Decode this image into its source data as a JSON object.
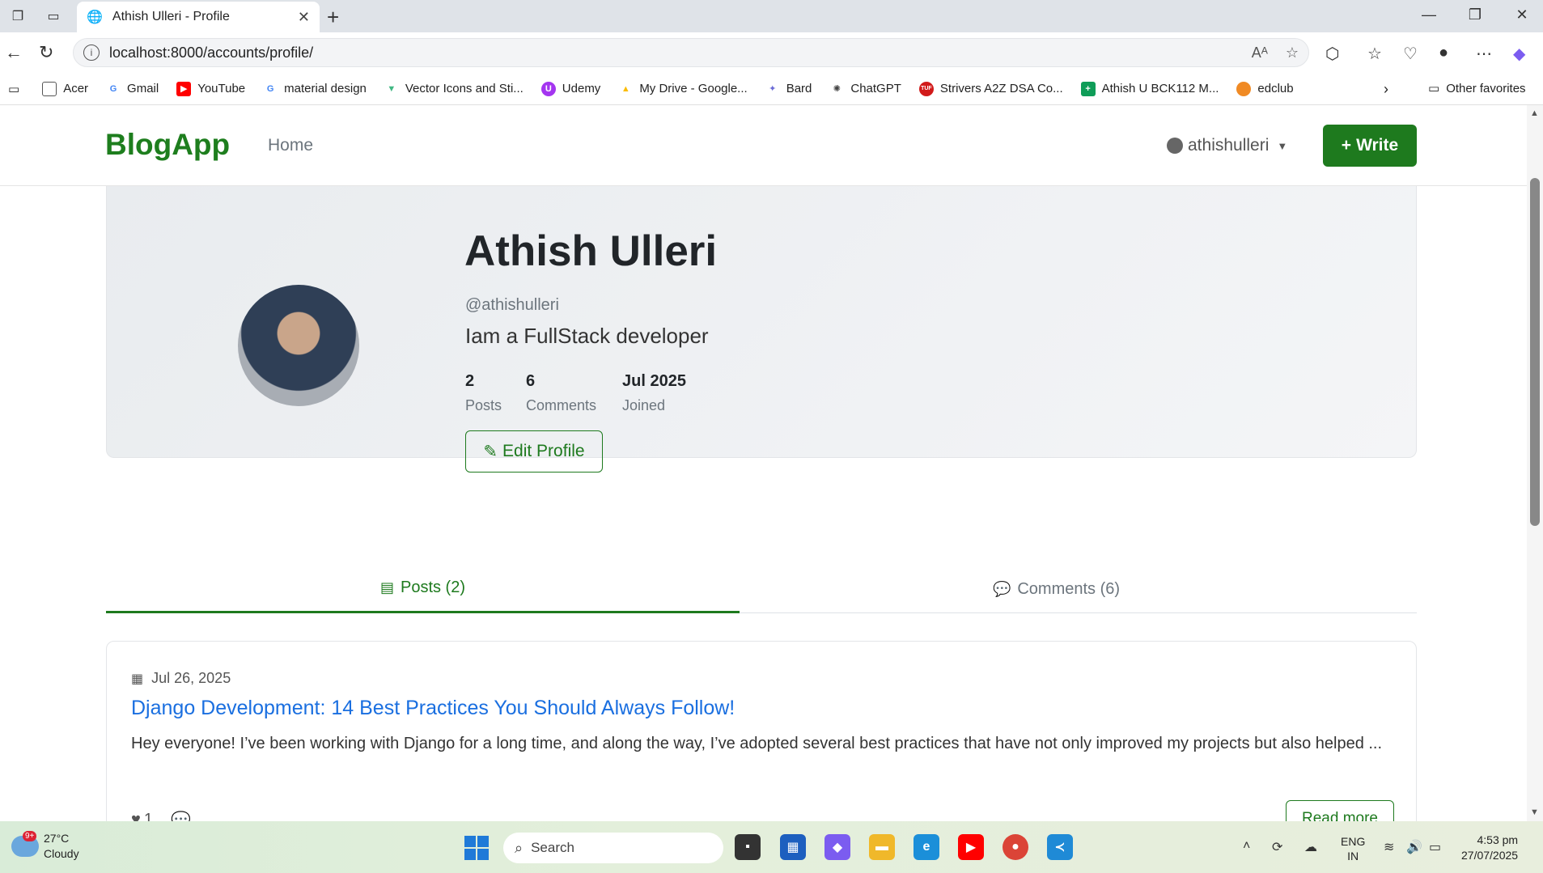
{
  "browser": {
    "tab_title": "Athish Ulleri - Profile",
    "url": "localhost:8000/accounts/profile/",
    "bookmarks": [
      {
        "label": "Acer",
        "icon": "folder-icon",
        "color": "#555555"
      },
      {
        "label": "Gmail",
        "icon": "google-icon",
        "color": "#4285f4"
      },
      {
        "label": "YouTube",
        "icon": "youtube-icon",
        "color": "#ff0000"
      },
      {
        "label": "material design",
        "icon": "google-icon",
        "color": "#4285f4"
      },
      {
        "label": "Vector Icons and Sti...",
        "icon": "vector-icon",
        "color": "#41b883"
      },
      {
        "label": "Udemy",
        "icon": "udemy-icon",
        "color": "#a435f0"
      },
      {
        "label": "My Drive - Google...",
        "icon": "drive-icon",
        "color": "#fbbc04"
      },
      {
        "label": "Bard",
        "icon": "sparkle-icon",
        "color": "#6b6bd6"
      },
      {
        "label": "ChatGPT",
        "icon": "chatgpt-icon",
        "color": "#444444"
      },
      {
        "label": "Strivers A2Z DSA Co...",
        "icon": "tuf-icon",
        "color": "#d11a1a"
      },
      {
        "label": "Athish U BCK112 M...",
        "icon": "sheets-icon",
        "color": "#0f9d58"
      },
      {
        "label": "edclub",
        "icon": "edclub-icon",
        "color": "#f08a24"
      }
    ],
    "other_favorites": "Other favorites"
  },
  "navbar": {
    "brand": "BlogApp",
    "home": "Home",
    "username": "athishulleri",
    "write": "Write"
  },
  "profile": {
    "name": "Athish Ulleri",
    "handle": "@athishulleri",
    "bio": "Iam a FullStack developer",
    "stats": [
      {
        "value": "2",
        "label": "Posts"
      },
      {
        "value": "6",
        "label": "Comments"
      },
      {
        "value": "Jul 2025",
        "label": "Joined"
      }
    ],
    "edit_label": "Edit Profile"
  },
  "tabs": {
    "posts": "Posts (2)",
    "comments": "Comments (6)"
  },
  "post": {
    "date": "Jul 26, 2025",
    "title": "Django Development: 14 Best Practices You Should Always Follow!",
    "excerpt": "Hey everyone! I’ve been working with Django for a long time, and along the way, I’ve adopted several best practices that have not only improved my projects but also helped ...",
    "likes": "1",
    "read_more": "Read more"
  },
  "taskbar": {
    "badge": "9+",
    "temp": "27°C",
    "weather": "Cloudy",
    "search": "Search",
    "lang1": "ENG",
    "lang2": "IN",
    "time": "4:53 pm",
    "date": "27/07/2025"
  },
  "colors": {
    "brand_green": "#1e7a1e",
    "link_blue": "#1a6fe0"
  }
}
